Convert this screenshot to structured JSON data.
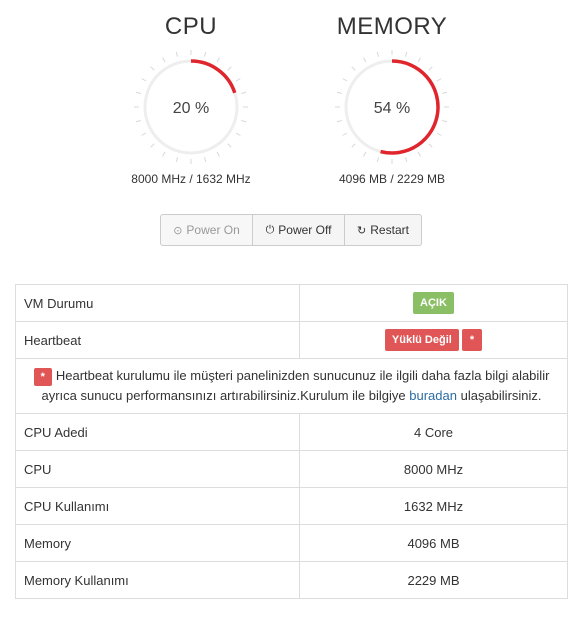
{
  "cpu": {
    "title": "CPU",
    "percent_label": "20 %",
    "percent": 20,
    "detail": "8000 MHz / 1632 MHz"
  },
  "memory": {
    "title": "MEMORY",
    "percent_label": "54 %",
    "percent": 54,
    "detail": "4096 MB / 2229 MB"
  },
  "controls": {
    "power_on": "Power On",
    "power_off": "Power Off",
    "restart": "Restart"
  },
  "table": {
    "vm_status_label": "VM Durumu",
    "vm_status_value": "AÇIK",
    "heartbeat_label": "Heartbeat",
    "heartbeat_value": "Yüklü Değil",
    "heartbeat_star": "*",
    "note_star": "*",
    "note_text_1": "Heartbeat kurulumu ile müşteri panelinizden sunucunuz ile ilgili daha fazla bilgi alabilir ayrıca sunucu performansınızı artırabilirsiniz.Kurulum ile bilgiye",
    "note_link": "buradan",
    "note_text_2": "ulaşabilirsiniz.",
    "rows": [
      {
        "label": "CPU Adedi",
        "value": "4 Core"
      },
      {
        "label": "CPU",
        "value": "8000 MHz"
      },
      {
        "label": "CPU Kullanımı",
        "value": "1632 MHz"
      },
      {
        "label": "Memory",
        "value": "4096 MB"
      },
      {
        "label": "Memory Kullanımı",
        "value": "2229 MB"
      }
    ]
  },
  "colors": {
    "gauge_fill": "#e0262d",
    "gauge_track": "#eeeeee",
    "badge_green": "#8bbf66",
    "badge_red": "#e05556",
    "link": "#2b6ca3"
  },
  "icons": {
    "power_on": "power-on-icon",
    "power_off": "power-off-icon",
    "restart": "refresh-icon"
  }
}
